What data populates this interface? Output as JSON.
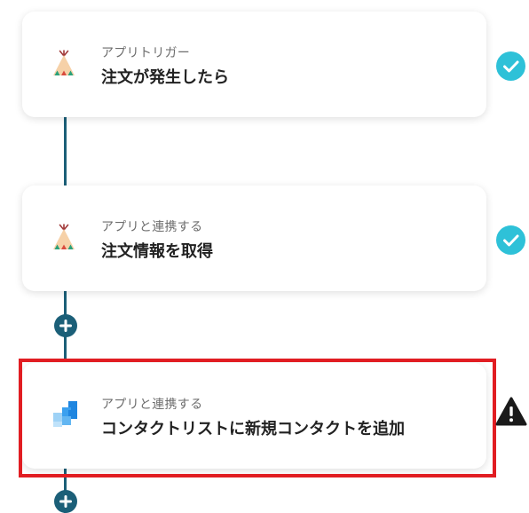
{
  "workflow": {
    "steps": [
      {
        "subtitle": "アプリトリガー",
        "title": "注文が発生したら",
        "app_icon": "teepee-icon",
        "status": "complete"
      },
      {
        "subtitle": "アプリと連携する",
        "title": "注文情報を取得",
        "app_icon": "teepee-icon",
        "status": "complete"
      },
      {
        "subtitle": "アプリと連携する",
        "title": "コンタクトリストに新規コンタクトを追加",
        "app_icon": "blue-squares-icon",
        "status": "warning"
      }
    ],
    "add_step_icon": "plus-icon"
  },
  "colors": {
    "connector": "#1b5f78",
    "check": "#2ec1d8",
    "highlight": "#e11d22",
    "warning": "#1a1a1a"
  }
}
